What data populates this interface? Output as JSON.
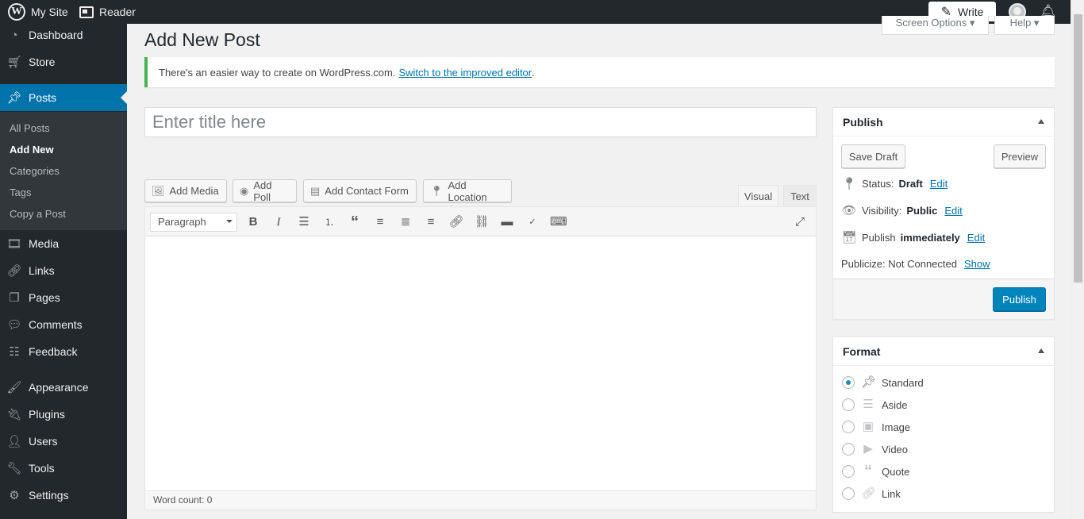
{
  "topbar": {
    "site_label": "My Site",
    "reader_label": "Reader",
    "write_label": "Write",
    "icons": [
      "wordpress-logo-icon",
      "reader-icon",
      "write-icon",
      "avatar",
      "notifications-icon"
    ]
  },
  "sidebar": {
    "items": [
      {
        "label": "Dashboard",
        "icon": "dashboard-icon"
      },
      {
        "label": "Store",
        "icon": "cart-icon"
      },
      {
        "label": "Posts",
        "icon": "pin-icon"
      },
      {
        "label": "Media",
        "icon": "media-icon"
      },
      {
        "label": "Links",
        "icon": "link-icon"
      },
      {
        "label": "Pages",
        "icon": "pages-icon"
      },
      {
        "label": "Comments",
        "icon": "comment-icon"
      },
      {
        "label": "Feedback",
        "icon": "feedback-icon"
      },
      {
        "label": "Appearance",
        "icon": "brush-icon"
      },
      {
        "label": "Plugins",
        "icon": "plugin-icon"
      },
      {
        "label": "Users",
        "icon": "user-icon"
      },
      {
        "label": "Tools",
        "icon": "wrench-icon"
      },
      {
        "label": "Settings",
        "icon": "settings-icon"
      }
    ],
    "submenu": [
      "All Posts",
      "Add New",
      "Categories",
      "Tags",
      "Copy a Post"
    ],
    "active": "Posts",
    "active_sub": "Add New"
  },
  "header": {
    "title": "Add New Post",
    "screen_options": "Screen Options ▾",
    "help": "Help ▾"
  },
  "notice": {
    "text": "There's an easier way to create on WordPress.com.",
    "link": "Switch to the improved editor",
    "suffix": "."
  },
  "editor": {
    "title_placeholder": "Enter title here",
    "buttons": [
      "Add Media",
      "Add Poll",
      "Add Contact Form",
      "Add Location"
    ],
    "tabs": [
      "Visual",
      "Text"
    ],
    "active_tab": "Visual",
    "format_value": "Paragraph",
    "word_count": "Word count: 0"
  },
  "publish": {
    "title": "Publish",
    "save_draft": "Save Draft",
    "preview": "Preview",
    "status_label": "Status:",
    "status_value": "Draft",
    "visibility_label": "Visibility:",
    "visibility_value": "Public",
    "publish_label": "Publish",
    "publish_value": "immediately",
    "edit": "Edit",
    "publicize": "Publicize: Not Connected",
    "show": "Show",
    "publish_button": "Publish"
  },
  "format": {
    "title": "Format",
    "options": [
      "Standard",
      "Aside",
      "Image",
      "Video",
      "Quote",
      "Link"
    ],
    "selected": "Standard"
  },
  "colors": {
    "admin_bar": "#23282d",
    "accent": "#0073aa",
    "primary_button": "#0085ba",
    "notice_border": "#46b450"
  }
}
